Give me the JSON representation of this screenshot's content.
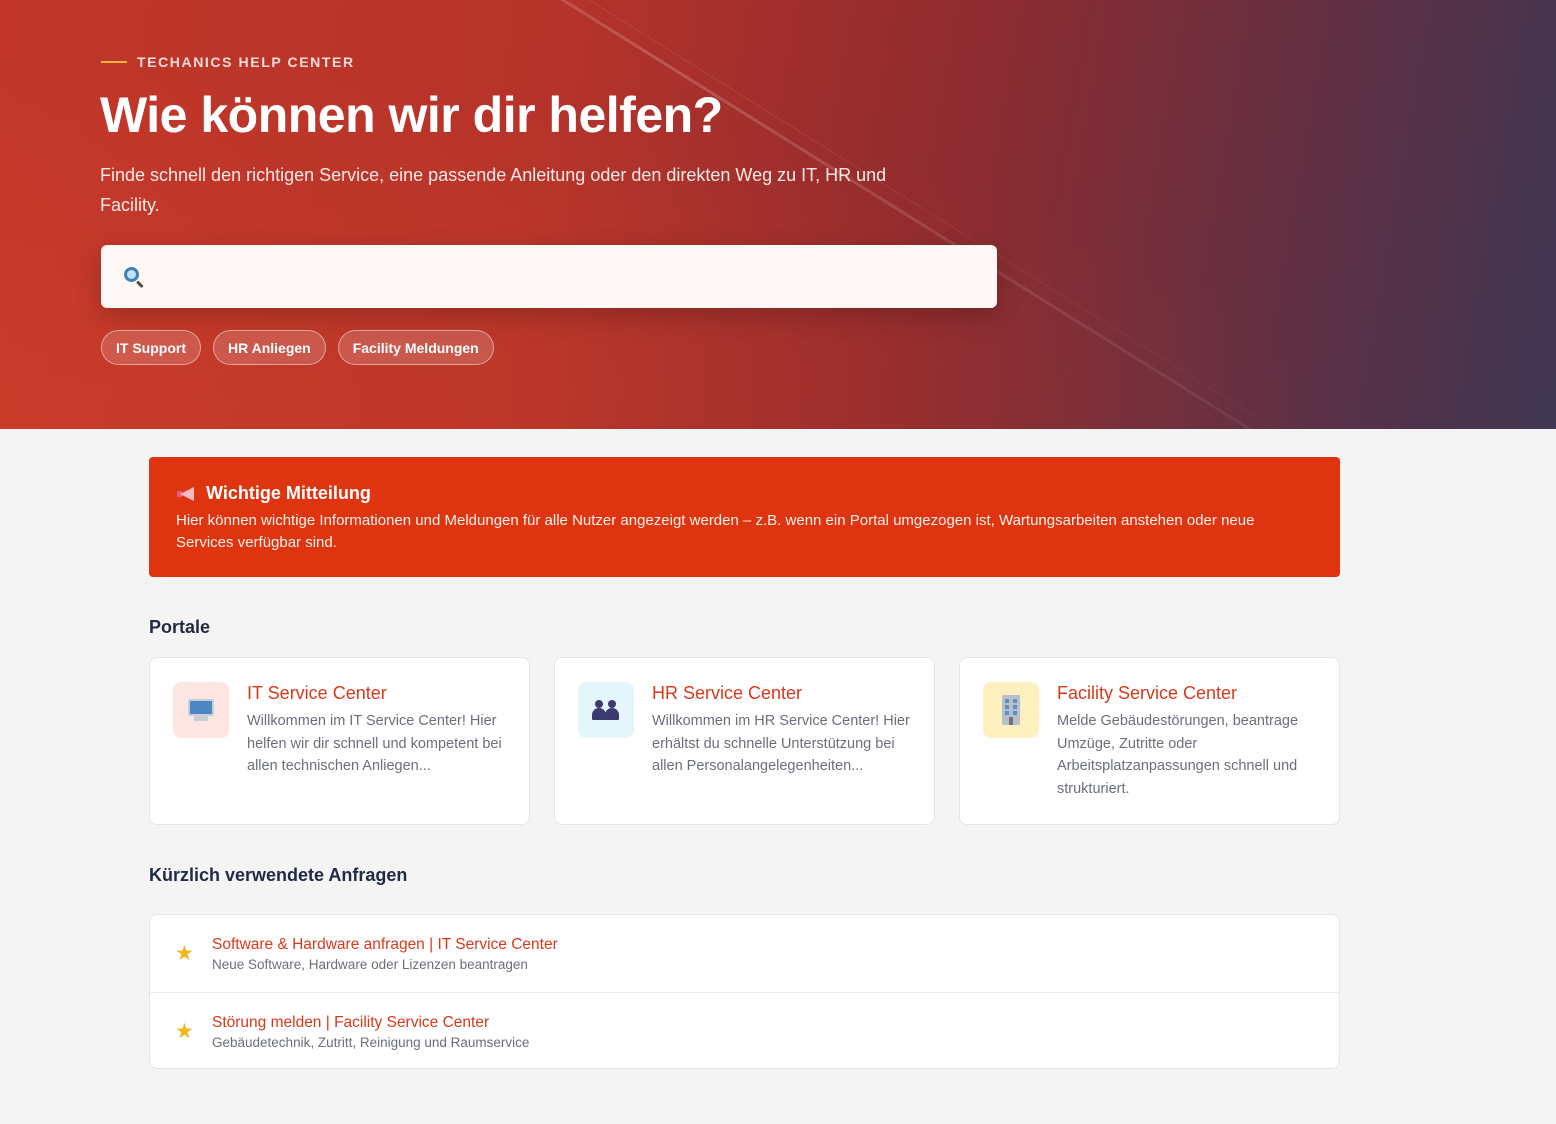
{
  "hero": {
    "eyebrow": "TECHANICS HELP CENTER",
    "title": "Wie können wir dir helfen?",
    "subtitle": "Finde schnell den richtigen Service, eine passende Anleitung oder den direkten Weg zu IT, HR und Facility.",
    "search": {
      "placeholder": "",
      "value": ""
    },
    "chips": [
      "IT Support",
      "HR Anliegen",
      "Facility Meldungen"
    ]
  },
  "notice": {
    "icon": "megaphone-icon",
    "title": "Wichtige Mitteilung",
    "text": "Hier können wichtige Informationen und Meldungen für alle Nutzer angezeigt werden – z.B. wenn ein Portal umgezogen ist, Wartungsarbeiten anstehen oder neue Services verfügbar sind."
  },
  "portals": {
    "heading": "Portale",
    "items": [
      {
        "icon": "monitor-icon",
        "title": "IT Service Center",
        "description": "Willkommen im IT Service Center! Hier helfen wir dir schnell und kompetent bei allen technischen Anliegen..."
      },
      {
        "icon": "people-icon",
        "title": "HR Service Center",
        "description": "Willkommen im HR Service Center! Hier erhältst du schnelle Unterstützung bei allen Personalangelegenheiten..."
      },
      {
        "icon": "building-icon",
        "title": "Facility Service Center",
        "description": "Melde Gebäudestörungen, beantrage Umzüge, Zutritte oder Arbeitsplatzanpassungen schnell und strukturiert."
      }
    ]
  },
  "recent": {
    "heading": "Kürzlich verwendete Anfragen",
    "items": [
      {
        "icon": "star-icon",
        "title": "Software & Hardware anfragen | IT Service Center",
        "subtitle": "Neue Software, Hardware oder Lizenzen beantragen"
      },
      {
        "icon": "star-icon",
        "title": "Störung melden | Facility Service Center",
        "subtitle": "Gebäudetechnik, Zutritt, Reinigung und Raumservice"
      }
    ]
  },
  "colors": {
    "accent": "#d9391a",
    "notice_bg": "#de340f",
    "hero_start": "#c2372a",
    "hero_end": "#3e3652",
    "eyebrow_line": "#f3b23a"
  }
}
